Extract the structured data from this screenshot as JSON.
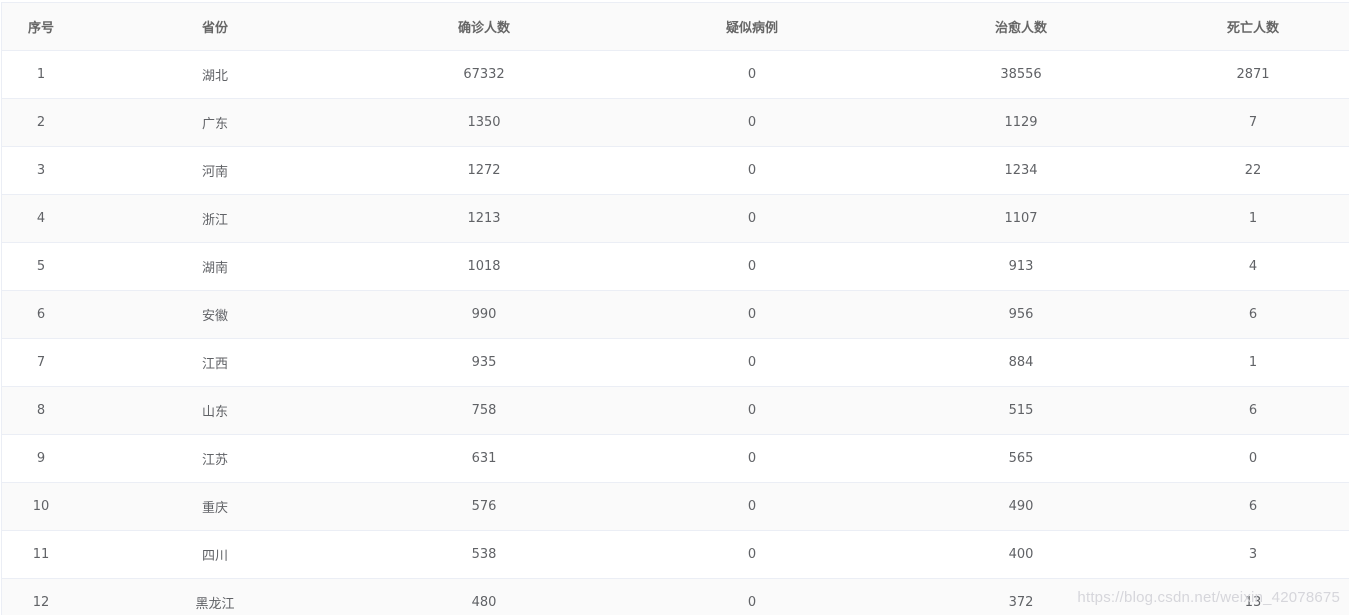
{
  "table": {
    "headers": [
      "序号",
      "省份",
      "确诊人数",
      "疑似病例",
      "治愈人数",
      "死亡人数"
    ],
    "rows": [
      [
        "1",
        "湖北",
        "67332",
        "0",
        "38556",
        "2871"
      ],
      [
        "2",
        "广东",
        "1350",
        "0",
        "1129",
        "7"
      ],
      [
        "3",
        "河南",
        "1272",
        "0",
        "1234",
        "22"
      ],
      [
        "4",
        "浙江",
        "1213",
        "0",
        "1107",
        "1"
      ],
      [
        "5",
        "湖南",
        "1018",
        "0",
        "913",
        "4"
      ],
      [
        "6",
        "安徽",
        "990",
        "0",
        "956",
        "6"
      ],
      [
        "7",
        "江西",
        "935",
        "0",
        "884",
        "1"
      ],
      [
        "8",
        "山东",
        "758",
        "0",
        "515",
        "6"
      ],
      [
        "9",
        "江苏",
        "631",
        "0",
        "565",
        "0"
      ],
      [
        "10",
        "重庆",
        "576",
        "0",
        "490",
        "6"
      ],
      [
        "11",
        "四川",
        "538",
        "0",
        "400",
        "3"
      ],
      [
        "12",
        "黑龙江",
        "480",
        "0",
        "372",
        "13"
      ]
    ]
  },
  "watermark": "https://blog.csdn.net/weixin_42078675",
  "colors": {
    "header_bg": "#fafafa",
    "stripe_bg": "#fafafa",
    "border": "#ebeef5",
    "text": "#606266"
  }
}
